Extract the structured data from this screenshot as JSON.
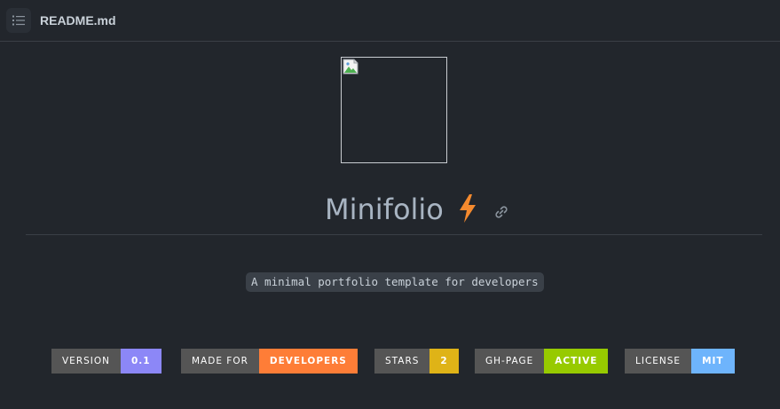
{
  "header": {
    "file_name": "README.md"
  },
  "title": {
    "text": "Minifolio"
  },
  "description": "A minimal portfolio template for developers",
  "badges": [
    {
      "label": "VERSION",
      "value": "0.1",
      "color": "#8c87f7"
    },
    {
      "label": "MADE FOR",
      "value": "DEVELOPERS",
      "color": "#fe7d37"
    },
    {
      "label": "STARS",
      "value": "2",
      "color": "#dfb317"
    },
    {
      "label": "GH-PAGE",
      "value": "ACTIVE",
      "color": "#97ca00"
    },
    {
      "label": "LICENSE",
      "value": "MIT",
      "color": "#6eb4fc"
    }
  ],
  "colors": {
    "background": "#22262c",
    "accent_bolt": "#f58a2e"
  },
  "icons": {
    "toc": "list-icon",
    "bolt": "lightning-bolt-icon",
    "anchor": "link-icon",
    "broken_image": "broken-image-icon"
  }
}
